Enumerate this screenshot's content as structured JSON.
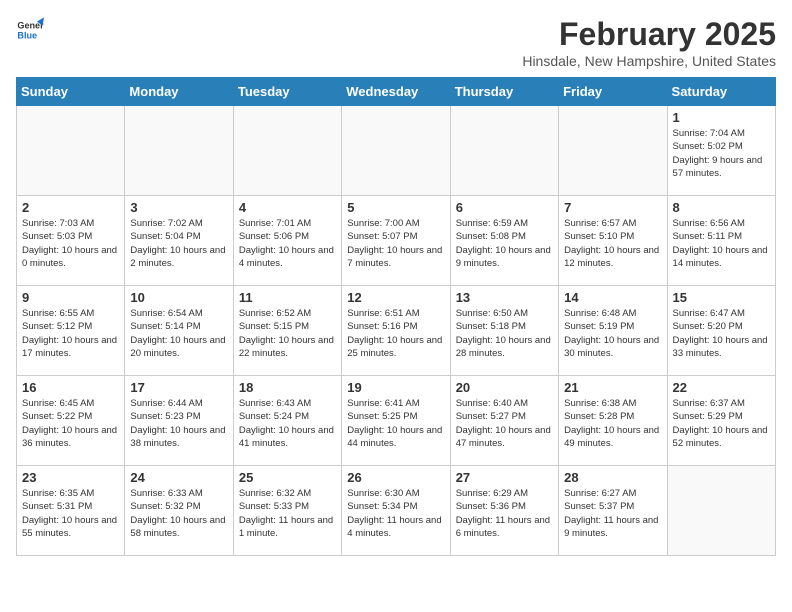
{
  "header": {
    "logo_general": "General",
    "logo_blue": "Blue",
    "month_year": "February 2025",
    "location": "Hinsdale, New Hampshire, United States"
  },
  "weekdays": [
    "Sunday",
    "Monday",
    "Tuesday",
    "Wednesday",
    "Thursday",
    "Friday",
    "Saturday"
  ],
  "weeks": [
    [
      {
        "day": "",
        "info": ""
      },
      {
        "day": "",
        "info": ""
      },
      {
        "day": "",
        "info": ""
      },
      {
        "day": "",
        "info": ""
      },
      {
        "day": "",
        "info": ""
      },
      {
        "day": "",
        "info": ""
      },
      {
        "day": "1",
        "info": "Sunrise: 7:04 AM\nSunset: 5:02 PM\nDaylight: 9 hours and 57 minutes."
      }
    ],
    [
      {
        "day": "2",
        "info": "Sunrise: 7:03 AM\nSunset: 5:03 PM\nDaylight: 10 hours and 0 minutes."
      },
      {
        "day": "3",
        "info": "Sunrise: 7:02 AM\nSunset: 5:04 PM\nDaylight: 10 hours and 2 minutes."
      },
      {
        "day": "4",
        "info": "Sunrise: 7:01 AM\nSunset: 5:06 PM\nDaylight: 10 hours and 4 minutes."
      },
      {
        "day": "5",
        "info": "Sunrise: 7:00 AM\nSunset: 5:07 PM\nDaylight: 10 hours and 7 minutes."
      },
      {
        "day": "6",
        "info": "Sunrise: 6:59 AM\nSunset: 5:08 PM\nDaylight: 10 hours and 9 minutes."
      },
      {
        "day": "7",
        "info": "Sunrise: 6:57 AM\nSunset: 5:10 PM\nDaylight: 10 hours and 12 minutes."
      },
      {
        "day": "8",
        "info": "Sunrise: 6:56 AM\nSunset: 5:11 PM\nDaylight: 10 hours and 14 minutes."
      }
    ],
    [
      {
        "day": "9",
        "info": "Sunrise: 6:55 AM\nSunset: 5:12 PM\nDaylight: 10 hours and 17 minutes."
      },
      {
        "day": "10",
        "info": "Sunrise: 6:54 AM\nSunset: 5:14 PM\nDaylight: 10 hours and 20 minutes."
      },
      {
        "day": "11",
        "info": "Sunrise: 6:52 AM\nSunset: 5:15 PM\nDaylight: 10 hours and 22 minutes."
      },
      {
        "day": "12",
        "info": "Sunrise: 6:51 AM\nSunset: 5:16 PM\nDaylight: 10 hours and 25 minutes."
      },
      {
        "day": "13",
        "info": "Sunrise: 6:50 AM\nSunset: 5:18 PM\nDaylight: 10 hours and 28 minutes."
      },
      {
        "day": "14",
        "info": "Sunrise: 6:48 AM\nSunset: 5:19 PM\nDaylight: 10 hours and 30 minutes."
      },
      {
        "day": "15",
        "info": "Sunrise: 6:47 AM\nSunset: 5:20 PM\nDaylight: 10 hours and 33 minutes."
      }
    ],
    [
      {
        "day": "16",
        "info": "Sunrise: 6:45 AM\nSunset: 5:22 PM\nDaylight: 10 hours and 36 minutes."
      },
      {
        "day": "17",
        "info": "Sunrise: 6:44 AM\nSunset: 5:23 PM\nDaylight: 10 hours and 38 minutes."
      },
      {
        "day": "18",
        "info": "Sunrise: 6:43 AM\nSunset: 5:24 PM\nDaylight: 10 hours and 41 minutes."
      },
      {
        "day": "19",
        "info": "Sunrise: 6:41 AM\nSunset: 5:25 PM\nDaylight: 10 hours and 44 minutes."
      },
      {
        "day": "20",
        "info": "Sunrise: 6:40 AM\nSunset: 5:27 PM\nDaylight: 10 hours and 47 minutes."
      },
      {
        "day": "21",
        "info": "Sunrise: 6:38 AM\nSunset: 5:28 PM\nDaylight: 10 hours and 49 minutes."
      },
      {
        "day": "22",
        "info": "Sunrise: 6:37 AM\nSunset: 5:29 PM\nDaylight: 10 hours and 52 minutes."
      }
    ],
    [
      {
        "day": "23",
        "info": "Sunrise: 6:35 AM\nSunset: 5:31 PM\nDaylight: 10 hours and 55 minutes."
      },
      {
        "day": "24",
        "info": "Sunrise: 6:33 AM\nSunset: 5:32 PM\nDaylight: 10 hours and 58 minutes."
      },
      {
        "day": "25",
        "info": "Sunrise: 6:32 AM\nSunset: 5:33 PM\nDaylight: 11 hours and 1 minute."
      },
      {
        "day": "26",
        "info": "Sunrise: 6:30 AM\nSunset: 5:34 PM\nDaylight: 11 hours and 4 minutes."
      },
      {
        "day": "27",
        "info": "Sunrise: 6:29 AM\nSunset: 5:36 PM\nDaylight: 11 hours and 6 minutes."
      },
      {
        "day": "28",
        "info": "Sunrise: 6:27 AM\nSunset: 5:37 PM\nDaylight: 11 hours and 9 minutes."
      },
      {
        "day": "",
        "info": ""
      }
    ]
  ]
}
